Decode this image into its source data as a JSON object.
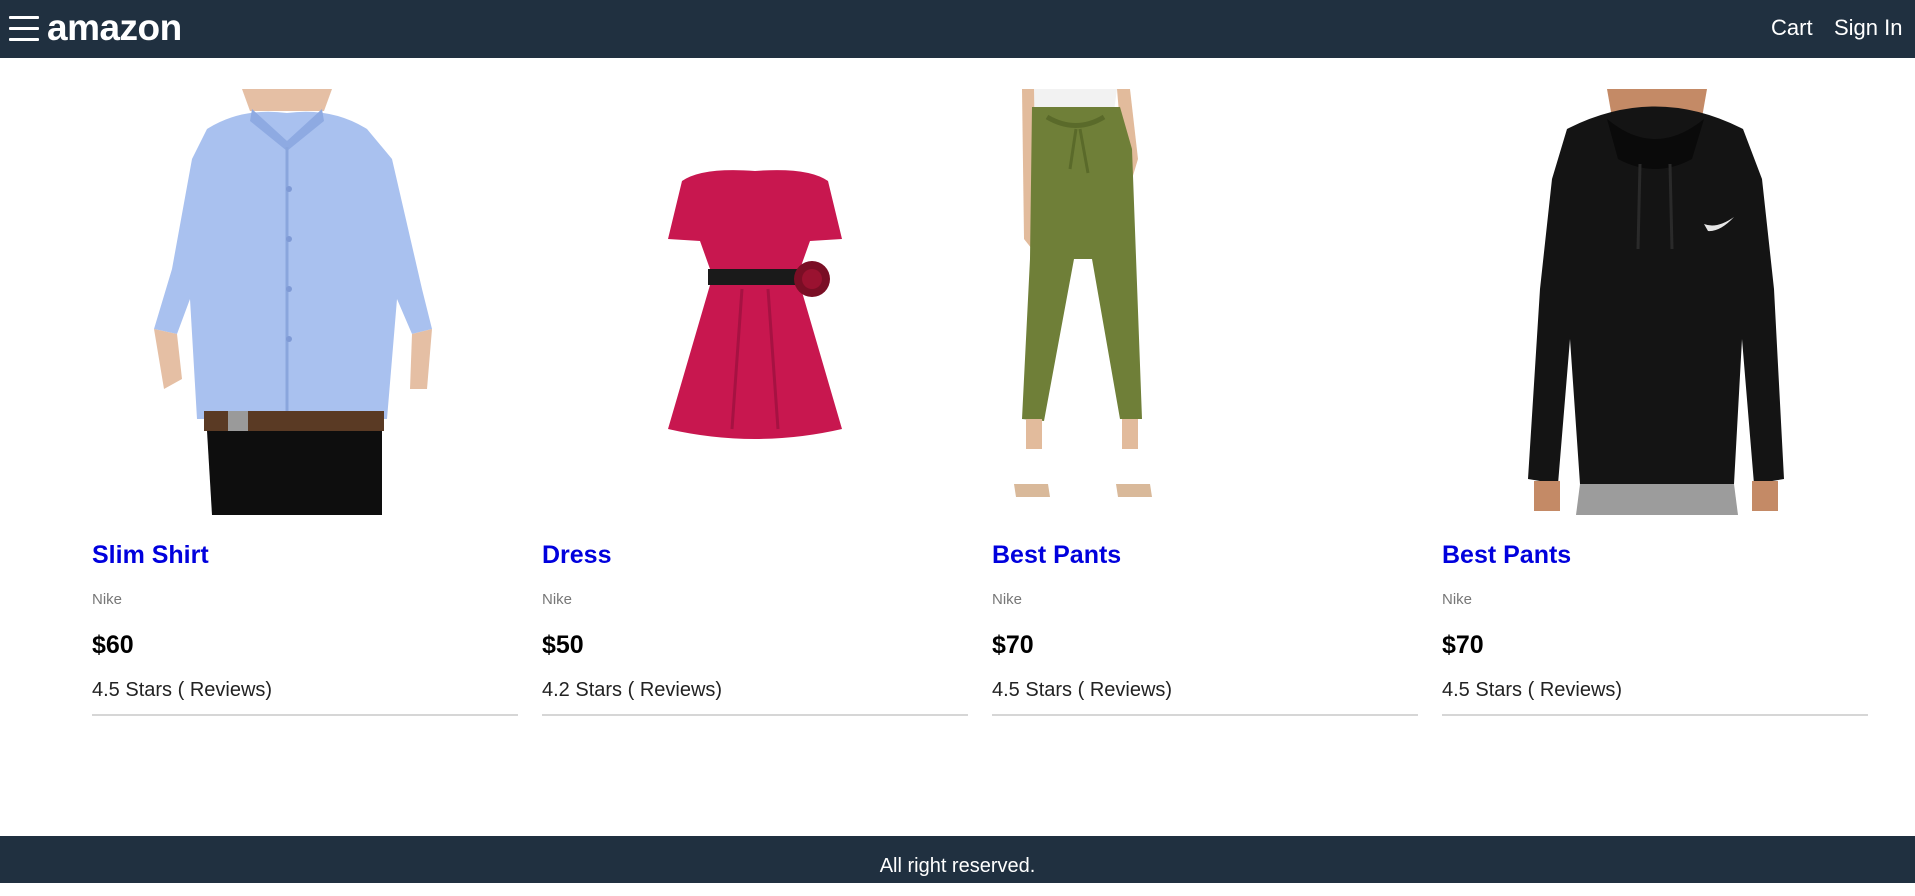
{
  "header": {
    "brand": "amazon",
    "cart_label": "Cart",
    "signin_label": "Sign In",
    "menu_icon": "hamburger-menu-icon"
  },
  "products": [
    {
      "name": "Slim Shirt",
      "brand": "Nike",
      "price": "$60",
      "rating": "4.5 Stars ( Reviews)",
      "image": "light-blue-shirt"
    },
    {
      "name": "Dress",
      "brand": "Nike",
      "price": "$50",
      "rating": "4.2 Stars ( Reviews)",
      "image": "pink-dress"
    },
    {
      "name": "Best Pants",
      "brand": "Nike",
      "price": "$70",
      "rating": "4.5 Stars ( Reviews)",
      "image": "olive-pants"
    },
    {
      "name": "Best Pants",
      "brand": "Nike",
      "price": "$70",
      "rating": "4.5 Stars ( Reviews)",
      "image": "black-hoodie"
    }
  ],
  "footer": {
    "text": "All right reserved."
  },
  "colors": {
    "header_bg": "#203040",
    "link": "#0000dd",
    "shirt": "#a9c1ef",
    "dress": "#c8174f",
    "pants": "#6f7f38",
    "hoodie": "#141414"
  }
}
